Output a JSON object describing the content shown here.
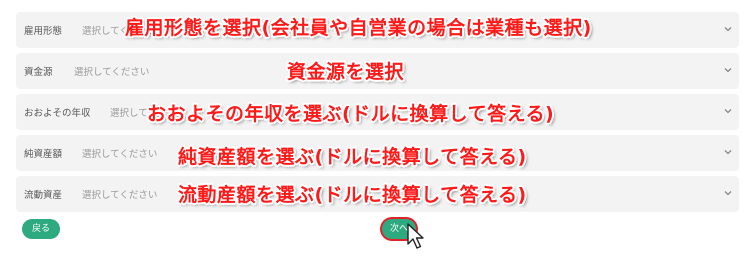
{
  "form": {
    "fields": [
      {
        "label": "雇用形態",
        "placeholder": "選択してください"
      },
      {
        "label": "資金源",
        "placeholder": "選択してください"
      },
      {
        "label": "おおよその年収",
        "placeholder": "選択してください"
      },
      {
        "label": "純資産額",
        "placeholder": "選択してください"
      },
      {
        "label": "流動資産",
        "placeholder": "選択してください"
      }
    ],
    "back_label": "戻る",
    "next_label": "次へ"
  },
  "annotations": [
    "雇用形態を選択(会社員や自営業の場合は業種も選択)",
    "資金源を選択",
    "おおよその年収を選ぶ(ドルに換算して答える)",
    "純資産額を選ぶ(ドルに換算して答える)",
    "流動産額を選ぶ(ドルに換算して答える)"
  ],
  "colors": {
    "field_bg": "#f3f3f3",
    "button_green": "#2eaa80",
    "annotation_red": "#ff1a1a",
    "highlight_ring": "#e0232a"
  },
  "icons": [
    "chevron-down-icon",
    "mouse-pointer-icon"
  ]
}
